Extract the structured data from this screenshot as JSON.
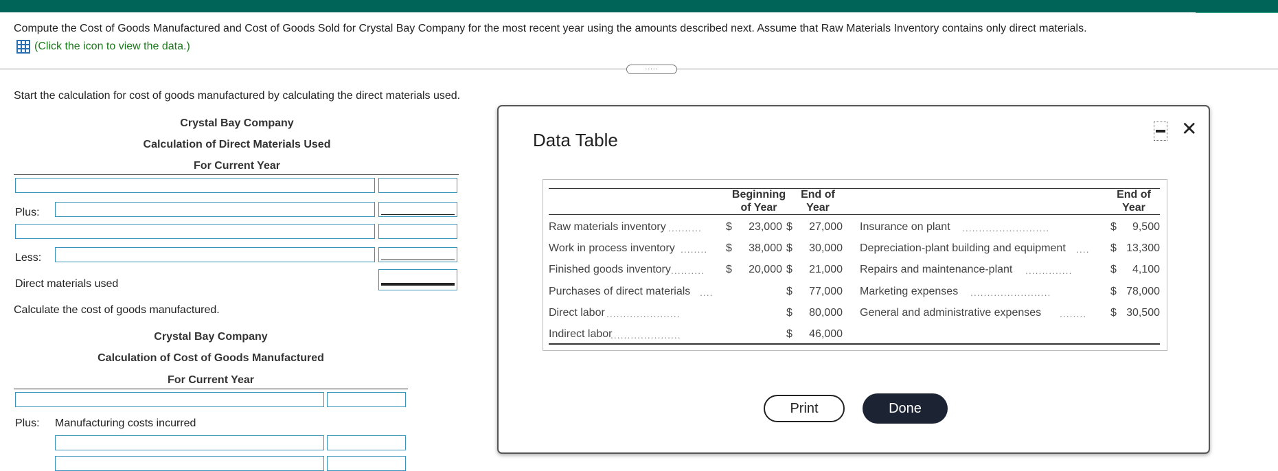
{
  "header": {
    "accent": "#006559"
  },
  "prompt": {
    "text": "Compute the Cost of Goods Manufactured and Cost of Goods Sold for Crystal Bay Company for the most recent year using the amounts described next. Assume that Raw Materials Inventory contains only direct materials.",
    "data_link": "(Click the icon to view the data.)",
    "data_icon": "table-grid-icon"
  },
  "handle": {
    "label": "....."
  },
  "section1": {
    "instruction": "Start the calculation for cost of goods manufactured by calculating the direct materials used.",
    "company": "Crystal Bay Company",
    "title": "Calculation of Direct Materials Used",
    "period": "For Current Year",
    "plus_label": "Plus:",
    "less_label": "Less:",
    "total_label": "Direct materials used"
  },
  "section2": {
    "instruction": "Calculate the cost of goods manufactured.",
    "company": "Crystal Bay Company",
    "title": "Calculation of Cost of Goods Manufactured",
    "period": "For Current Year",
    "plus_label": "Plus:",
    "mfg_label": "Manufacturing costs incurred"
  },
  "modal": {
    "title": "Data Table",
    "minimize_icon": "minimize-icon",
    "close_icon": "close-icon",
    "print_label": "Print",
    "done_label": "Done",
    "table": {
      "col_begin": [
        "Beginning",
        "of Year"
      ],
      "col_end": [
        "End of",
        "Year"
      ],
      "col_end2": [
        "End of",
        "Year"
      ],
      "left_rows": [
        {
          "label": "Raw materials inventory",
          "begin_sym": "$",
          "begin": "23,000",
          "end_sym": "$",
          "end": "27,000"
        },
        {
          "label": "Work in process inventory",
          "begin_sym": "$",
          "begin": "38,000",
          "end_sym": "$",
          "end": "30,000"
        },
        {
          "label": "Finished goods inventory",
          "begin_sym": "$",
          "begin": "20,000",
          "end_sym": "$",
          "end": "21,000"
        },
        {
          "label": "Purchases of direct materials",
          "begin_sym": "",
          "begin": "",
          "end_sym": "$",
          "end": "77,000"
        },
        {
          "label": "Direct labor",
          "begin_sym": "",
          "begin": "",
          "end_sym": "$",
          "end": "80,000"
        },
        {
          "label": "Indirect labor",
          "begin_sym": "",
          "begin": "",
          "end_sym": "$",
          "end": "46,000"
        }
      ],
      "right_rows": [
        {
          "label": "Insurance on plant",
          "sym": "$",
          "value": "9,500"
        },
        {
          "label": "Depreciation-plant building and equipment",
          "sym": "$",
          "value": "13,300"
        },
        {
          "label": "Repairs and maintenance-plant",
          "sym": "$",
          "value": "4,100"
        },
        {
          "label": "Marketing expenses",
          "sym": "$",
          "value": "78,000"
        },
        {
          "label": "General and administrative expenses",
          "sym": "$",
          "value": "30,500"
        }
      ]
    }
  }
}
